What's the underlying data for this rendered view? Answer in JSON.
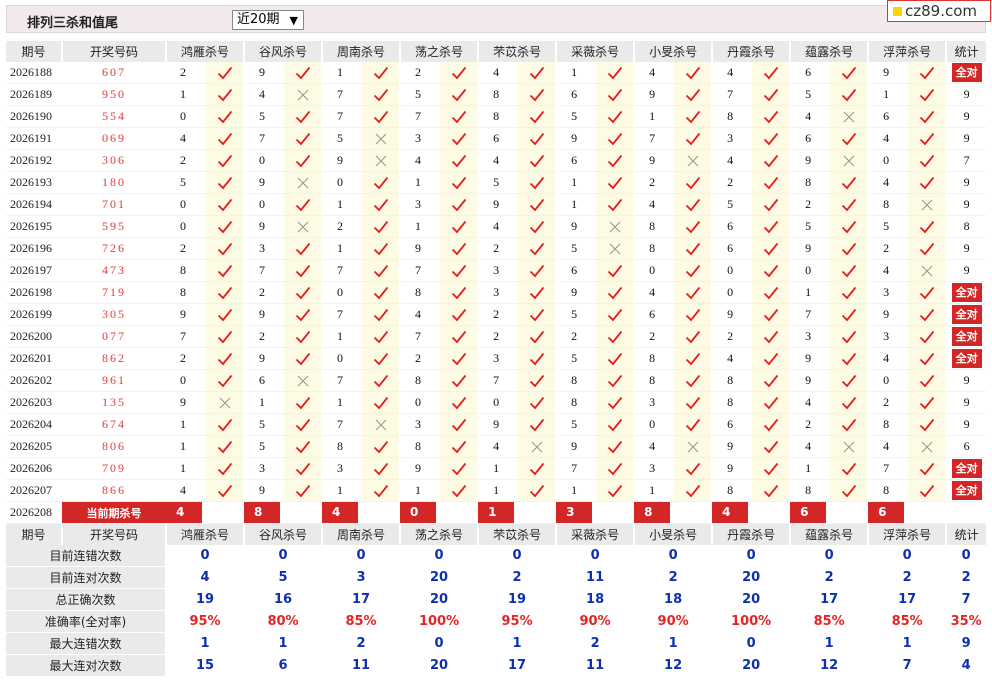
{
  "header": {
    "title": "排列三杀和值尾",
    "range_select": "近20期",
    "brand": "cz89.com"
  },
  "table": {
    "col_period": "期号",
    "col_number": "开奖号码",
    "experts": [
      "鸿雁杀号",
      "谷风杀号",
      "周南杀号",
      "荡之杀号",
      "芣苡杀号",
      "采薇杀号",
      "小旻杀号",
      "丹霞杀号",
      "蕴露杀号",
      "浮萍杀号"
    ],
    "col_stat": "统计",
    "all_correct_label": "全对",
    "rows": [
      {
        "p": "2026188",
        "n": "607",
        "v": [
          2,
          9,
          1,
          2,
          4,
          1,
          4,
          4,
          6,
          9
        ],
        "r": [
          1,
          1,
          1,
          1,
          1,
          1,
          1,
          1,
          1,
          1
        ],
        "s": "全对"
      },
      {
        "p": "2026189",
        "n": "950",
        "v": [
          1,
          4,
          7,
          5,
          8,
          6,
          9,
          7,
          5,
          1
        ],
        "r": [
          1,
          0,
          1,
          1,
          1,
          1,
          1,
          1,
          1,
          1
        ],
        "s": "9"
      },
      {
        "p": "2026190",
        "n": "554",
        "v": [
          0,
          5,
          7,
          7,
          8,
          5,
          1,
          8,
          4,
          6
        ],
        "r": [
          1,
          1,
          1,
          1,
          1,
          1,
          1,
          1,
          0,
          1
        ],
        "s": "9"
      },
      {
        "p": "2026191",
        "n": "069",
        "v": [
          4,
          7,
          5,
          3,
          6,
          9,
          7,
          3,
          6,
          4
        ],
        "r": [
          1,
          1,
          0,
          1,
          1,
          1,
          1,
          1,
          1,
          1
        ],
        "s": "9"
      },
      {
        "p": "2026192",
        "n": "306",
        "v": [
          2,
          0,
          9,
          4,
          4,
          6,
          9,
          4,
          9,
          0
        ],
        "r": [
          1,
          1,
          0,
          1,
          1,
          1,
          0,
          1,
          0,
          1
        ],
        "s": "7"
      },
      {
        "p": "2026193",
        "n": "180",
        "v": [
          5,
          9,
          0,
          1,
          5,
          1,
          2,
          2,
          8,
          4
        ],
        "r": [
          1,
          0,
          1,
          1,
          1,
          1,
          1,
          1,
          1,
          1
        ],
        "s": "9"
      },
      {
        "p": "2026194",
        "n": "701",
        "v": [
          0,
          0,
          1,
          3,
          9,
          1,
          4,
          5,
          2,
          8
        ],
        "r": [
          1,
          1,
          1,
          1,
          1,
          1,
          1,
          1,
          1,
          0
        ],
        "s": "9"
      },
      {
        "p": "2026195",
        "n": "595",
        "v": [
          0,
          9,
          2,
          1,
          4,
          9,
          8,
          6,
          5,
          5
        ],
        "r": [
          1,
          0,
          1,
          1,
          1,
          0,
          1,
          1,
          1,
          1
        ],
        "s": "8"
      },
      {
        "p": "2026196",
        "n": "726",
        "v": [
          2,
          3,
          1,
          9,
          2,
          5,
          8,
          6,
          9,
          2
        ],
        "r": [
          1,
          1,
          1,
          1,
          1,
          0,
          1,
          1,
          1,
          1
        ],
        "s": "9"
      },
      {
        "p": "2026197",
        "n": "473",
        "v": [
          8,
          7,
          7,
          7,
          3,
          6,
          0,
          0,
          0,
          4
        ],
        "r": [
          1,
          1,
          1,
          1,
          1,
          1,
          1,
          1,
          1,
          0
        ],
        "s": "9"
      },
      {
        "p": "2026198",
        "n": "719",
        "v": [
          8,
          2,
          0,
          8,
          3,
          9,
          4,
          0,
          1,
          3
        ],
        "r": [
          1,
          1,
          1,
          1,
          1,
          1,
          1,
          1,
          1,
          1
        ],
        "s": "全对"
      },
      {
        "p": "2026199",
        "n": "305",
        "v": [
          9,
          9,
          7,
          4,
          2,
          5,
          6,
          9,
          7,
          9
        ],
        "r": [
          1,
          1,
          1,
          1,
          1,
          1,
          1,
          1,
          1,
          1
        ],
        "s": "全对"
      },
      {
        "p": "2026200",
        "n": "077",
        "v": [
          7,
          2,
          1,
          7,
          2,
          2,
          2,
          2,
          3,
          3
        ],
        "r": [
          1,
          1,
          1,
          1,
          1,
          1,
          1,
          1,
          1,
          1
        ],
        "s": "全对"
      },
      {
        "p": "2026201",
        "n": "862",
        "v": [
          2,
          9,
          0,
          2,
          3,
          5,
          8,
          4,
          9,
          4
        ],
        "r": [
          1,
          1,
          1,
          1,
          1,
          1,
          1,
          1,
          1,
          1
        ],
        "s": "全对"
      },
      {
        "p": "2026202",
        "n": "961",
        "v": [
          0,
          6,
          7,
          8,
          7,
          8,
          8,
          8,
          9,
          0
        ],
        "r": [
          1,
          0,
          1,
          1,
          1,
          1,
          1,
          1,
          1,
          1
        ],
        "s": "9"
      },
      {
        "p": "2026203",
        "n": "135",
        "v": [
          9,
          1,
          1,
          0,
          0,
          8,
          3,
          8,
          4,
          2
        ],
        "r": [
          0,
          1,
          1,
          1,
          1,
          1,
          1,
          1,
          1,
          1
        ],
        "s": "9"
      },
      {
        "p": "2026204",
        "n": "674",
        "v": [
          1,
          5,
          7,
          3,
          9,
          5,
          0,
          6,
          2,
          8
        ],
        "r": [
          1,
          1,
          0,
          1,
          1,
          1,
          1,
          1,
          1,
          1
        ],
        "s": "9"
      },
      {
        "p": "2026205",
        "n": "806",
        "v": [
          1,
          5,
          8,
          8,
          4,
          9,
          4,
          9,
          4,
          4
        ],
        "r": [
          1,
          1,
          1,
          1,
          0,
          1,
          0,
          1,
          0,
          0
        ],
        "s": "6"
      },
      {
        "p": "2026206",
        "n": "709",
        "v": [
          1,
          3,
          3,
          9,
          1,
          7,
          3,
          9,
          1,
          7
        ],
        "r": [
          1,
          1,
          1,
          1,
          1,
          1,
          1,
          1,
          1,
          1
        ],
        "s": "全对"
      },
      {
        "p": "2026207",
        "n": "866",
        "v": [
          4,
          9,
          1,
          1,
          1,
          1,
          1,
          8,
          8,
          8
        ],
        "r": [
          1,
          1,
          1,
          1,
          1,
          1,
          1,
          1,
          1,
          1
        ],
        "s": "全对"
      }
    ],
    "current": {
      "p": "2026208",
      "label": "当前期杀号",
      "v": [
        4,
        8,
        4,
        0,
        1,
        3,
        8,
        4,
        6,
        6
      ]
    }
  },
  "stats": {
    "rows": [
      {
        "label": "目前连错次数",
        "vals": [
          "0",
          "0",
          "0",
          "0",
          "0",
          "0",
          "0",
          "0",
          "0",
          "0",
          "0"
        ]
      },
      {
        "label": "目前连对次数",
        "vals": [
          "4",
          "5",
          "3",
          "20",
          "2",
          "11",
          "2",
          "20",
          "2",
          "2",
          "2"
        ]
      },
      {
        "label": "总正确次数",
        "vals": [
          "19",
          "16",
          "17",
          "20",
          "19",
          "18",
          "18",
          "20",
          "17",
          "17",
          "7"
        ]
      },
      {
        "label": "准确率(全对率)",
        "vals": [
          "95%",
          "80%",
          "85%",
          "100%",
          "95%",
          "90%",
          "90%",
          "100%",
          "85%",
          "85%",
          "35%"
        ],
        "red": true
      },
      {
        "label": "最大连错次数",
        "vals": [
          "1",
          "1",
          "2",
          "0",
          "1",
          "2",
          "1",
          "0",
          "1",
          "1",
          "9"
        ]
      },
      {
        "label": "最大连对次数",
        "vals": [
          "15",
          "6",
          "11",
          "20",
          "17",
          "11",
          "12",
          "20",
          "12",
          "7",
          "4"
        ]
      }
    ]
  },
  "colors": {
    "accent_red": "#d32626",
    "number_red": "#e23c3c",
    "stat_blue": "#0d2fb3",
    "check_red": "#e02020",
    "cross_gray": "#999999"
  },
  "icons": {
    "correct": "check-icon",
    "wrong": "cross-icon"
  }
}
